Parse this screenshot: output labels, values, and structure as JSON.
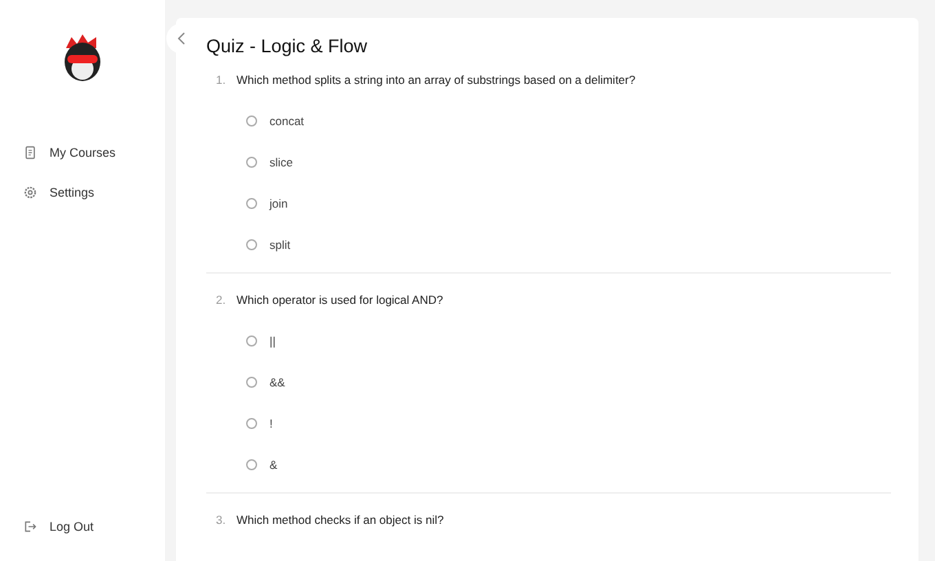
{
  "sidebar": {
    "items": [
      {
        "label": "My Courses",
        "kind": "courses"
      },
      {
        "label": "Settings",
        "kind": "settings"
      }
    ],
    "footer": {
      "label": "Log Out",
      "kind": "logout"
    }
  },
  "quiz": {
    "title": "Quiz - Logic & Flow",
    "questions": [
      {
        "number": "1.",
        "text": "Which method splits a string into an array of substrings based on a delimiter?",
        "options": [
          {
            "label": "concat",
            "selected": false
          },
          {
            "label": "slice",
            "selected": false
          },
          {
            "label": "join",
            "selected": false
          },
          {
            "label": "split",
            "selected": false
          }
        ]
      },
      {
        "number": "2.",
        "text": "Which operator is used for logical AND?",
        "options": [
          {
            "label": "||",
            "selected": false
          },
          {
            "label": "&&",
            "selected": false
          },
          {
            "label": "!",
            "selected": false
          },
          {
            "label": "&",
            "selected": false
          }
        ]
      },
      {
        "number": "3.",
        "text": "Which method checks if an object is nil?"
      }
    ]
  }
}
